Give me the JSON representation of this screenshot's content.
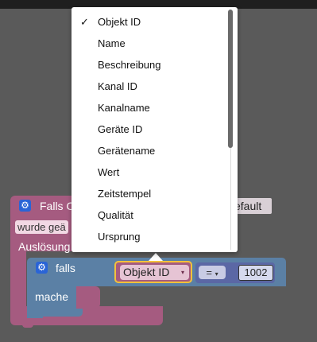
{
  "event_block": {
    "title": "Falls O",
    "trigger_field": "wurde geä",
    "default_field": "efault",
    "ausloesung_label": "Auslösung"
  },
  "if_block": {
    "falls_label": "falls",
    "mache_label": "mache"
  },
  "comparison": {
    "selected_property": "Objekt ID",
    "operator": "=",
    "value": "1002"
  },
  "dropdown": {
    "items": [
      {
        "label": "Objekt ID",
        "checked": "✓"
      },
      {
        "label": "Name",
        "checked": ""
      },
      {
        "label": "Beschreibung",
        "checked": ""
      },
      {
        "label": "Kanal ID",
        "checked": ""
      },
      {
        "label": "Kanalname",
        "checked": ""
      },
      {
        "label": "Geräte ID",
        "checked": ""
      },
      {
        "label": "Gerätename",
        "checked": ""
      },
      {
        "label": "Wert",
        "checked": ""
      },
      {
        "label": "Zeitstempel",
        "checked": ""
      },
      {
        "label": "Qualität",
        "checked": ""
      },
      {
        "label": "Ursprung",
        "checked": ""
      }
    ]
  },
  "icons": {
    "gear": "gear-icon",
    "caret": "▾",
    "check": "✓"
  }
}
